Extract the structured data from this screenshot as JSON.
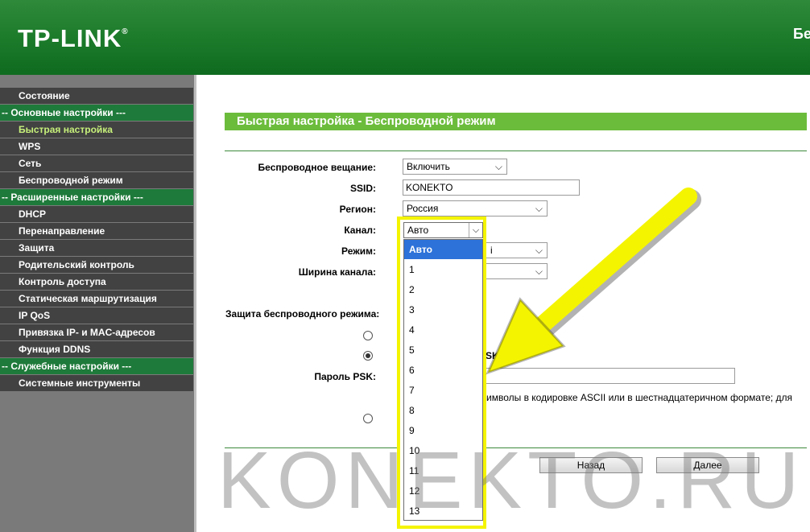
{
  "header": {
    "logo_text": "TP-LINK",
    "logo_mark": "®",
    "right_text": "Бес"
  },
  "sidebar": {
    "items": [
      {
        "label": "Состояние",
        "kind": "item"
      },
      {
        "label": "-- Основные настройки ---",
        "kind": "group"
      },
      {
        "label": "Быстрая настройка",
        "kind": "item",
        "active": true
      },
      {
        "label": "WPS",
        "kind": "item"
      },
      {
        "label": "Сеть",
        "kind": "item"
      },
      {
        "label": "Беспроводной режим",
        "kind": "item"
      },
      {
        "label": "-- Расширенные настройки ---",
        "kind": "group"
      },
      {
        "label": "DHCP",
        "kind": "item"
      },
      {
        "label": "Перенаправление",
        "kind": "item"
      },
      {
        "label": "Защита",
        "kind": "item"
      },
      {
        "label": "Родительский контроль",
        "kind": "item"
      },
      {
        "label": "Контроль доступа",
        "kind": "item"
      },
      {
        "label": "Статическая маршрутизация",
        "kind": "item"
      },
      {
        "label": "IP QoS",
        "kind": "item"
      },
      {
        "label": "Привязка IP- и MAC-адресов",
        "kind": "item"
      },
      {
        "label": "Функция DDNS",
        "kind": "item"
      },
      {
        "label": "-- Служебные настройки ---",
        "kind": "group"
      },
      {
        "label": "Системные инструменты",
        "kind": "item"
      }
    ]
  },
  "main": {
    "title": "Быстрая настройка - Беспроводной режим",
    "form": {
      "broadcast_label": "Беспроводное вещание:",
      "broadcast_value": "Включить",
      "ssid_label": "SSID:",
      "ssid_value": "KONEKTO",
      "region_label": "Регион:",
      "region_value": "Россия",
      "channel_label": "Канал:",
      "channel_value": "Авто",
      "mode_label": "Режим:",
      "mode_value_fragment": "i",
      "width_label": "Ширина канала:",
      "security_label": "Защита беспроводного режима:",
      "psk_fragment": "SK",
      "psk_label": "Пароль PSK:",
      "psk_value": "",
      "hint_fragment": "символы в кодировке ASCII или в шестнадцатеричном формате; для"
    },
    "buttons": {
      "back": "Назад",
      "next": "Далее"
    }
  },
  "dropdown": {
    "options": [
      "Авто",
      "1",
      "2",
      "3",
      "4",
      "5",
      "6",
      "7",
      "8",
      "9",
      "10",
      "11",
      "12",
      "13"
    ],
    "selected_index": 0
  },
  "annotation": {
    "color": "#f4f400"
  },
  "watermark": {
    "text": "KONEKTO.RU"
  },
  "colors": {
    "header_green": "#1a7a2a",
    "title_green": "#6cbc3c",
    "menu_group_green": "#1e7a3a",
    "menu_item_dark": "#424242",
    "active_item": "#c6f07a",
    "selection_blue": "#2d72d9"
  }
}
